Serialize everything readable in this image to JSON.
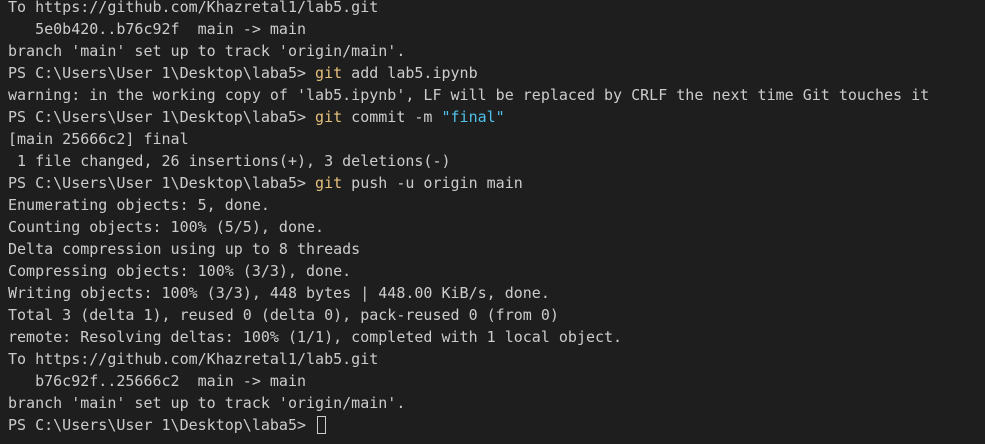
{
  "terminal": {
    "lines": [
      [
        {
          "t": "To https://github.com/Khazretal1/lab5.git",
          "k": "out"
        }
      ],
      [
        {
          "t": "   5e0b420..b76c92f  main -> main",
          "k": "out"
        }
      ],
      [
        {
          "t": "branch 'main' set up to track 'origin/main'.",
          "k": "out"
        }
      ],
      [
        {
          "t": "PS C:\\Users\\User 1\\Desktop\\laba5> ",
          "k": "prompt"
        },
        {
          "t": "git",
          "k": "cmd"
        },
        {
          "t": " add lab5.ipynb",
          "k": "arg"
        }
      ],
      [
        {
          "t": "warning: in the working copy of 'lab5.ipynb', LF will be replaced by CRLF the next time Git touches it",
          "k": "out"
        }
      ],
      [
        {
          "t": "PS C:\\Users\\User 1\\Desktop\\laba5> ",
          "k": "prompt"
        },
        {
          "t": "git",
          "k": "cmd"
        },
        {
          "t": " commit -m ",
          "k": "arg"
        },
        {
          "t": "\"final\"",
          "k": "str"
        }
      ],
      [
        {
          "t": "[main 25666c2] final",
          "k": "out"
        }
      ],
      [
        {
          "t": " 1 file changed, 26 insertions(+), 3 deletions(-)",
          "k": "out"
        }
      ],
      [
        {
          "t": "PS C:\\Users\\User 1\\Desktop\\laba5> ",
          "k": "prompt"
        },
        {
          "t": "git",
          "k": "cmd"
        },
        {
          "t": " push -u origin main",
          "k": "arg"
        }
      ],
      [
        {
          "t": "Enumerating objects: 5, done.",
          "k": "out"
        }
      ],
      [
        {
          "t": "Counting objects: 100% (5/5), done.",
          "k": "out"
        }
      ],
      [
        {
          "t": "Delta compression using up to 8 threads",
          "k": "out"
        }
      ],
      [
        {
          "t": "Compressing objects: 100% (3/3), done.",
          "k": "out"
        }
      ],
      [
        {
          "t": "Writing objects: 100% (3/3), 448 bytes | 448.00 KiB/s, done.",
          "k": "out"
        }
      ],
      [
        {
          "t": "Total 3 (delta 1), reused 0 (delta 0), pack-reused 0 (from 0)",
          "k": "out"
        }
      ],
      [
        {
          "t": "remote: Resolving deltas: 100% (1/1), completed with 1 local object.",
          "k": "out"
        }
      ],
      [
        {
          "t": "To https://github.com/Khazretal1/lab5.git",
          "k": "out"
        }
      ],
      [
        {
          "t": "   b76c92f..25666c2  main -> main",
          "k": "out"
        }
      ],
      [
        {
          "t": "branch 'main' set up to track 'origin/main'.",
          "k": "out"
        }
      ],
      [
        {
          "t": "PS C:\\Users\\User 1\\Desktop\\laba5> ",
          "k": "prompt"
        }
      ]
    ]
  },
  "colors": {
    "background": "#1e1e1e",
    "text": "#cccccc",
    "command": "#e5c07b",
    "string": "#4fc1e9"
  }
}
